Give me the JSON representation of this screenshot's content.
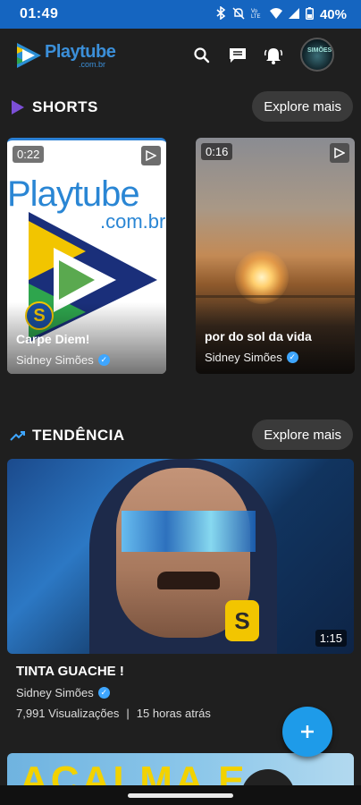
{
  "status_bar": {
    "time": "01:49",
    "battery": "40%",
    "network": "Vo LTE"
  },
  "header": {
    "brand": "Playtube",
    "brand_sub": ".com.br",
    "avatar_text": "SIMÕES"
  },
  "shorts": {
    "title": "SHORTS",
    "explore_label": "Explore mais",
    "items": [
      {
        "duration": "0:22",
        "title": "Carpe Diem!",
        "author": "Sidney Simões",
        "thumb_text_1": "Playtube",
        "thumb_text_2": ".com.br"
      },
      {
        "duration": "0:16",
        "title": "por do sol da vida",
        "author": "Sidney Simões"
      }
    ]
  },
  "trending": {
    "title": "TENDÊNCIA",
    "explore_label": "Explore mais",
    "video": {
      "title": "TINTA GUACHE !",
      "author": "Sidney Simões",
      "views": "7,991 Visualizações",
      "age": "15 horas atrás",
      "duration": "1:15"
    },
    "next_thumb_text": "ACALMA E"
  },
  "colors": {
    "status_bar": "#1565c0",
    "accent": "#1e9be9",
    "background": "#1f1f1f",
    "verified": "#3ea6ff",
    "shorts_icon": "#7b4fd6"
  },
  "icons": [
    "search-icon",
    "messages-icon",
    "bell-icon",
    "add-icon",
    "play-badge-icon",
    "verified-icon",
    "trending-icon",
    "shorts-icon"
  ]
}
